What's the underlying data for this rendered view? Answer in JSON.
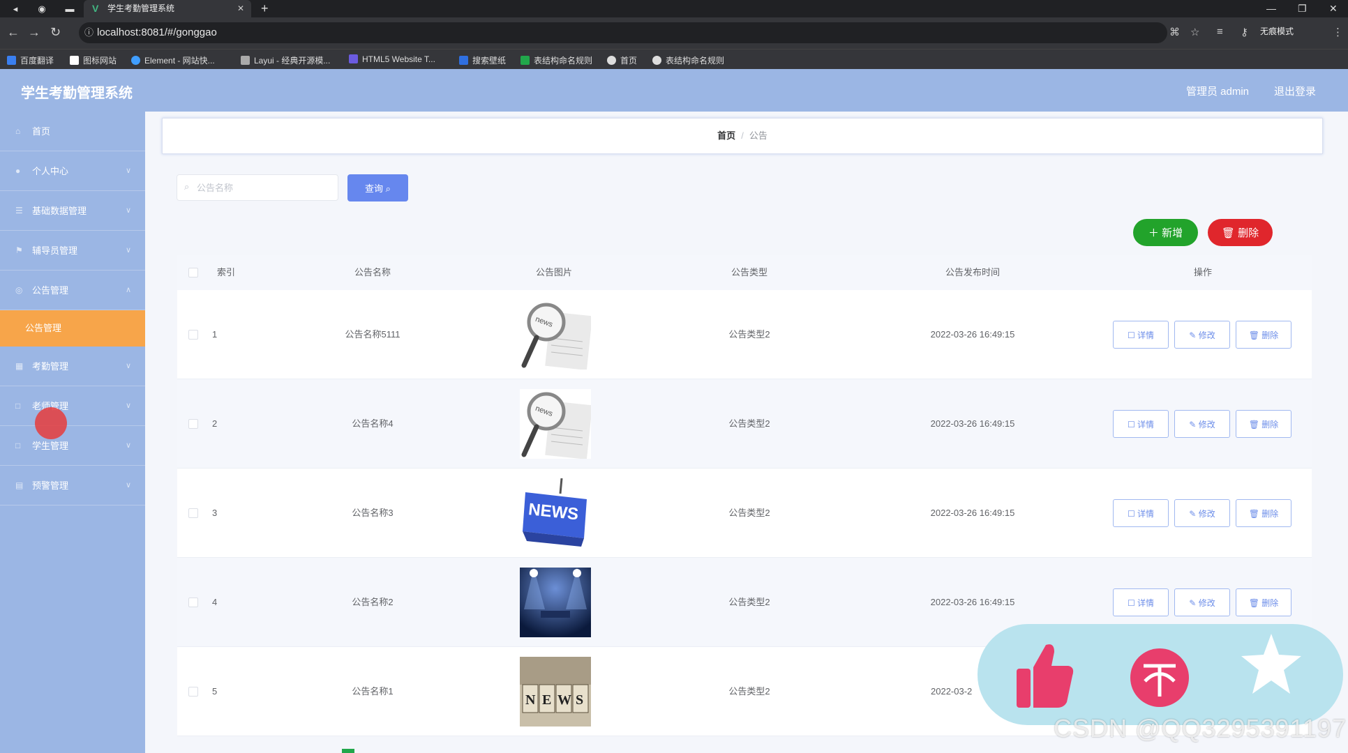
{
  "browser": {
    "tab_title": "学生考勤管理系统",
    "url": "localhost:8081/#/gonggao",
    "incognito_label": "无痕模式",
    "bookmarks": [
      "百度翻译",
      "图标网站",
      "Element - 网站快...",
      "Layui - 经典开源模...",
      "HTML5 Website T...",
      "搜索壁纸",
      "表结构命名规则",
      "首页",
      "表结构命名规则"
    ]
  },
  "header": {
    "title": "学生考勤管理系统",
    "user": "管理员 admin",
    "logout": "退出登录"
  },
  "sidebar": {
    "items": [
      {
        "label": "首页"
      },
      {
        "label": "个人中心"
      },
      {
        "label": "基础数据管理"
      },
      {
        "label": "辅导员管理"
      },
      {
        "label": "公告管理"
      },
      {
        "label": "公告管理"
      },
      {
        "label": "考勤管理"
      },
      {
        "label": "老师管理"
      },
      {
        "label": "学生管理"
      },
      {
        "label": "预警管理"
      }
    ]
  },
  "breadcrumb": {
    "home": "首页",
    "current": "公告"
  },
  "search": {
    "placeholder": "公告名称",
    "query_button": "查询"
  },
  "toolbar": {
    "add": "新增",
    "delete": "删除"
  },
  "table": {
    "headers": {
      "index": "索引",
      "name": "公告名称",
      "image": "公告图片",
      "type": "公告类型",
      "time": "公告发布时间",
      "ops": "操作"
    },
    "rows": [
      {
        "index": "1",
        "name": "公告名称5111",
        "type": "公告类型2",
        "time": "2022-03-26 16:49:15",
        "image": "magnifier-news"
      },
      {
        "index": "2",
        "name": "公告名称4",
        "type": "公告类型2",
        "time": "2022-03-26 16:49:15",
        "image": "magnifier-news"
      },
      {
        "index": "3",
        "name": "公告名称3",
        "type": "公告类型2",
        "time": "2022-03-26 16:49:15",
        "image": "news-key"
      },
      {
        "index": "4",
        "name": "公告名称2",
        "type": "公告类型2",
        "time": "2022-03-26 16:49:15",
        "image": "stage-lights"
      },
      {
        "index": "5",
        "name": "公告名称1",
        "type": "公告类型2",
        "time": "2022-03-2",
        "image": "news-blocks"
      }
    ],
    "actions": {
      "detail": "详情",
      "edit": "修改",
      "remove": "删除"
    }
  },
  "watermark": "CSDN @QQ3295391197",
  "colors": {
    "header": "#9bb6e4",
    "active_menu": "#f7a54a",
    "primary": "#6687ee",
    "success": "#22a32b",
    "danger": "#e0262c"
  }
}
